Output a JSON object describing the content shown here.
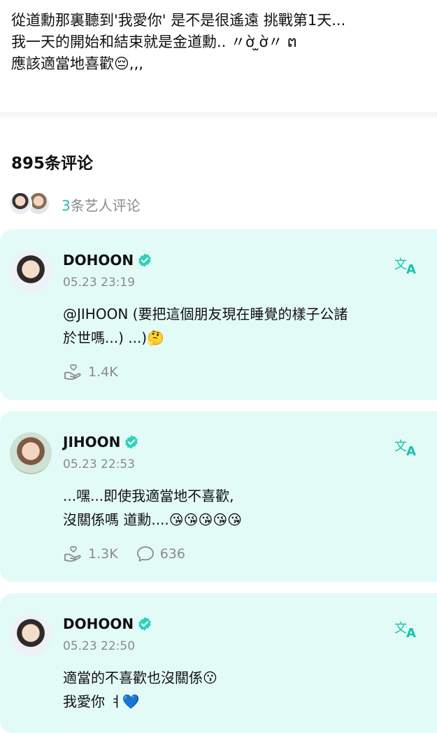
{
  "post": {
    "lines": [
      "從道勳那裏聽到'我愛你' 是不是很遙遠 挑戰第1天...",
      "我一天的開始和結束就是金道勳.. 〃ờ ̫ờ〃 ຕ",
      "應該適當地喜歡😔,,,"
    ]
  },
  "comments_header": {
    "count_label": "895条评论",
    "artist_count": "3",
    "artist_label": "条艺人评论"
  },
  "comments": [
    {
      "author": "DOHOON",
      "time": "05.23 23:19",
      "lines": [
        "@JIHOON (要把這個朋友現在睡覺的樣子公諸",
        "於世嗎...) ...)🤔"
      ],
      "likes": "1.4K",
      "replies": ""
    },
    {
      "author": "JIHOON",
      "time": "05.23 22:53",
      "lines": [
        "...嘿...即使我適當地不喜歡,",
        "沒關係嗎 道勳....😘😘😘😘😘"
      ],
      "likes": "1.3K",
      "replies": "636"
    },
    {
      "author": "DOHOON",
      "time": "05.23 22:50",
      "lines": [
        "適當的不喜歡也沒關係😗",
        "我愛你 ㅕ💙"
      ],
      "likes": "",
      "replies": ""
    }
  ],
  "icons": {
    "verified": "verified-badge-icon",
    "translate": "translate-icon",
    "like": "hand-heart-icon",
    "reply": "speech-bubble-icon"
  },
  "colors": {
    "accent": "#18c2b0",
    "card_bg": "#e3fbf7",
    "muted_text": "#8a8a8a"
  }
}
